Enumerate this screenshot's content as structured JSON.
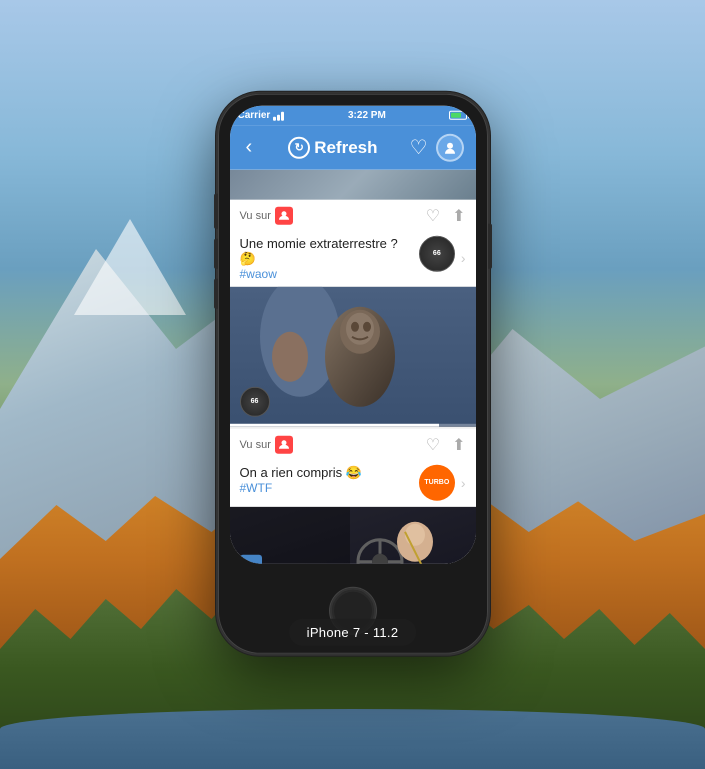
{
  "background": {
    "description": "Mountain landscape with blue sky, snow-capped peaks, orange autumn foliage, lake"
  },
  "device": {
    "label": "iPhone 7 - 11.2",
    "model": "iPhone 7"
  },
  "status_bar": {
    "carrier": "Carrier",
    "time": "3:22 PM",
    "battery_pct": 70
  },
  "nav_bar": {
    "back_label": "‹",
    "title": "Refresh",
    "heart_icon": "♡",
    "avatar_icon": "👤"
  },
  "card1": {
    "vu_sur_label": "Vu sur",
    "title": "Une momie extraterrestre ? 🤔",
    "tag": "#waow",
    "channel": "66",
    "heart_icon": "♡",
    "share_icon": "⬆"
  },
  "card2": {
    "vu_sur_label": "Vu sur",
    "title": "On a rien compris 😂",
    "tag": "#WTF",
    "channel": "TURBO",
    "heart_icon": "♡",
    "share_icon": "⬆"
  }
}
